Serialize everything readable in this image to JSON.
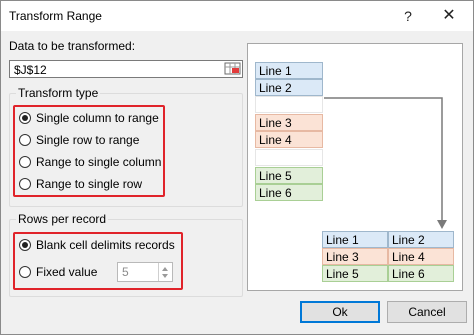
{
  "window": {
    "title": "Transform Range",
    "help_glyph": "?",
    "close_glyph": "✕"
  },
  "data_field": {
    "label": "Data to be transformed:",
    "value": "$J$12"
  },
  "transform_type": {
    "legend": "Transform type",
    "options": [
      {
        "label": "Single column to range",
        "selected": true
      },
      {
        "label": "Single row to range",
        "selected": false
      },
      {
        "label": "Range to single column",
        "selected": false
      },
      {
        "label": "Range to single row",
        "selected": false
      }
    ]
  },
  "rows_per_record": {
    "legend": "Rows per record",
    "options": [
      {
        "label": "Blank cell delimits records",
        "selected": true
      },
      {
        "label": "Fixed value",
        "selected": false
      }
    ],
    "fixed_value": "5"
  },
  "preview": {
    "column": [
      "Line 1",
      "Line 2",
      "",
      "Line 3",
      "Line 4",
      "",
      "Line 5",
      "Line 6"
    ],
    "result": [
      [
        "Line 1",
        "Line 2"
      ],
      [
        "Line 3",
        "Line 4"
      ],
      [
        "Line 5",
        "Line 6"
      ]
    ],
    "colors": {
      "blue": "#dbe9f7",
      "orange": "#fbe3d6",
      "green": "#e2efda",
      "arrow": "#7a7a7a"
    }
  },
  "buttons": {
    "ok": "Ok",
    "cancel": "Cancel"
  },
  "highlight_color": "#e0232a"
}
